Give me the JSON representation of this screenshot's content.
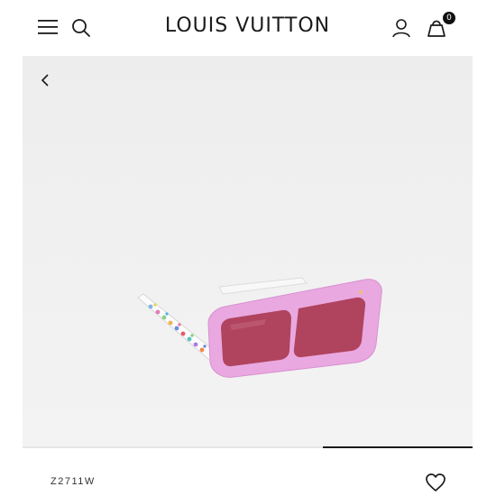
{
  "header": {
    "brand": "LOUIS VUITTON",
    "bag_count": "0",
    "icons": [
      "menu-icon",
      "search-icon",
      "account-icon",
      "shopping-bag-icon"
    ]
  },
  "hero": {
    "back_icon": "chevron-left-icon",
    "product_image": "pink rectangular sunglasses with multicolor monogram temples",
    "carousel": {
      "active_index": 3,
      "count": 3
    }
  },
  "product": {
    "sku": "Z2711W",
    "wishlist_icon": "heart-icon"
  },
  "colors": {
    "background": "#ffffff",
    "hero_bg": "#efefef",
    "text": "#1a1a1a",
    "frame_pink": "#e9a8e0",
    "lens": "#b0435e"
  }
}
